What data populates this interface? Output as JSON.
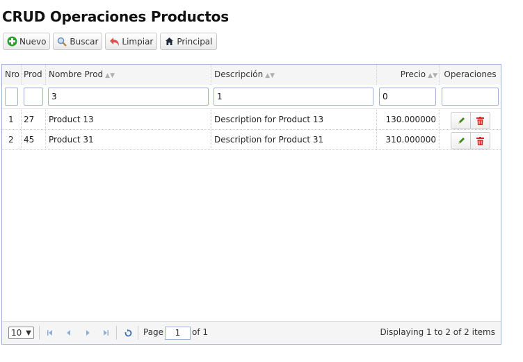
{
  "page": {
    "title": "CRUD Operaciones Productos"
  },
  "toolbar": {
    "new_label": "Nuevo",
    "search_label": "Buscar",
    "clear_label": "Limpiar",
    "home_label": "Principal"
  },
  "table": {
    "columns": [
      "Nro",
      "Prod",
      "Nombre Prod",
      "Descripción",
      "Precio",
      "Operaciones"
    ],
    "filters": {
      "nro": "",
      "prod": "",
      "nombre": "3",
      "descripcion": "1",
      "precio": "0",
      "operaciones": ""
    },
    "rows": [
      {
        "nro": "1",
        "prod": "27",
        "nombre": "Product 13",
        "descripcion": "Description for Product 13",
        "precio": "130.000000"
      },
      {
        "nro": "2",
        "prod": "45",
        "nombre": "Product 31",
        "descripcion": "Description for Product 31",
        "precio": "310.000000"
      }
    ]
  },
  "pager": {
    "page_size": "10",
    "page_label": "Page",
    "page_value": "1",
    "of_label": "of 1",
    "info": "Displaying 1 to 2 of 2 items"
  },
  "colors": {
    "accent_border": "#9cb3d6",
    "delete": "#e02424",
    "edit": "#3a8a1e",
    "add": "#2e9e2e"
  },
  "icons": {
    "new": "plus-icon",
    "search": "magnifier-icon",
    "clear": "undo-icon",
    "home": "home-icon",
    "edit": "pencil-icon",
    "delete": "trash-icon"
  }
}
